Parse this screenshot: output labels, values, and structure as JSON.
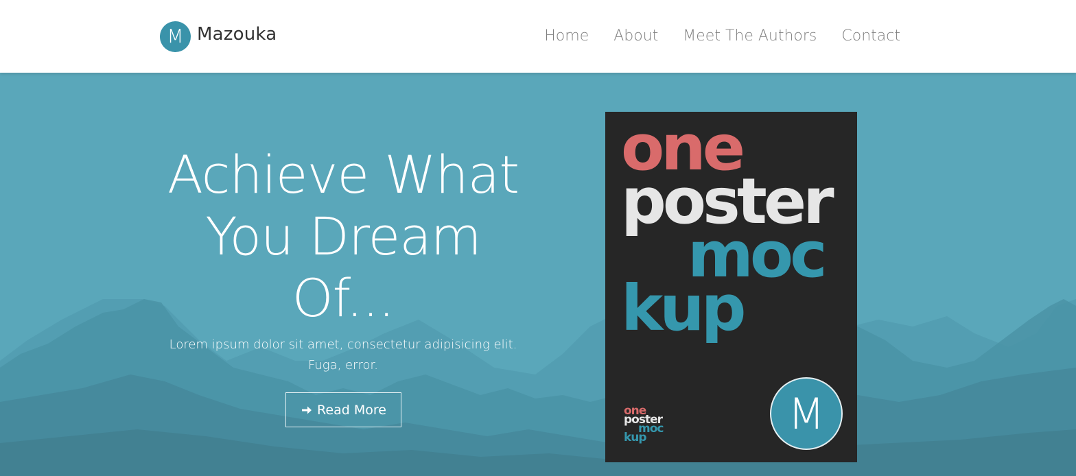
{
  "brand": {
    "logo_letter": "M",
    "name": "Mazouka"
  },
  "nav": {
    "items": [
      "Home",
      "About",
      "Meet The Authors",
      "Contact"
    ]
  },
  "hero": {
    "headline_lines": [
      "Achieve What",
      "You Dream",
      "Of..."
    ],
    "subtext": "Lorem ipsum dolor sit amet, consectetur adipisicing elit. Fuga, error.",
    "button_label": "Read More",
    "button_icon": "arrow-right-icon",
    "background_color": "#5aa7ba"
  },
  "poster": {
    "lines": [
      "one",
      "poster",
      "moc",
      "kup"
    ],
    "badge_letter": "M",
    "colors": {
      "one": "#d96b6b",
      "poster": "#e6e6e6",
      "mockup": "#3597ad",
      "background": "#262626"
    }
  }
}
